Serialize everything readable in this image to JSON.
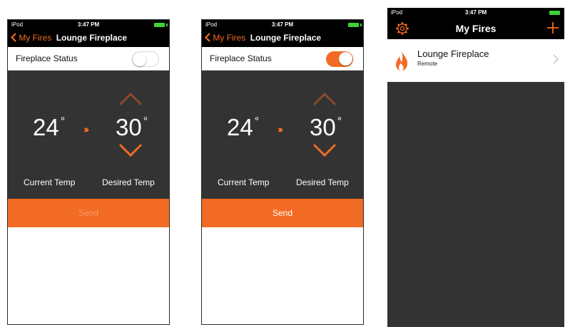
{
  "colors": {
    "accent": "#f26b24",
    "dark_bg": "#333333",
    "battery": "#3ed138"
  },
  "status_bar": {
    "carrier": "iPod",
    "time": "3:47 PM"
  },
  "detail_screen": {
    "back_label": "My Fires",
    "title": "Lounge Fireplace",
    "status_label": "Fireplace Status",
    "current_temp": "24",
    "desired_temp": "30",
    "degree_symbol": "°",
    "arrows": "›››",
    "current_temp_label": "Current Temp",
    "desired_temp_label": "Desired Temp",
    "send_label": "Send"
  },
  "screens": [
    {
      "toggle_state": "off",
      "send_state": "disabled"
    },
    {
      "toggle_state": "on",
      "send_state": "enabled"
    }
  ],
  "list_screen": {
    "title": "My Fires",
    "icons": {
      "left": "gear-icon",
      "right": "plus-icon"
    },
    "items": [
      {
        "name": "Lounge Fireplace",
        "subtitle": "Remote"
      }
    ]
  }
}
